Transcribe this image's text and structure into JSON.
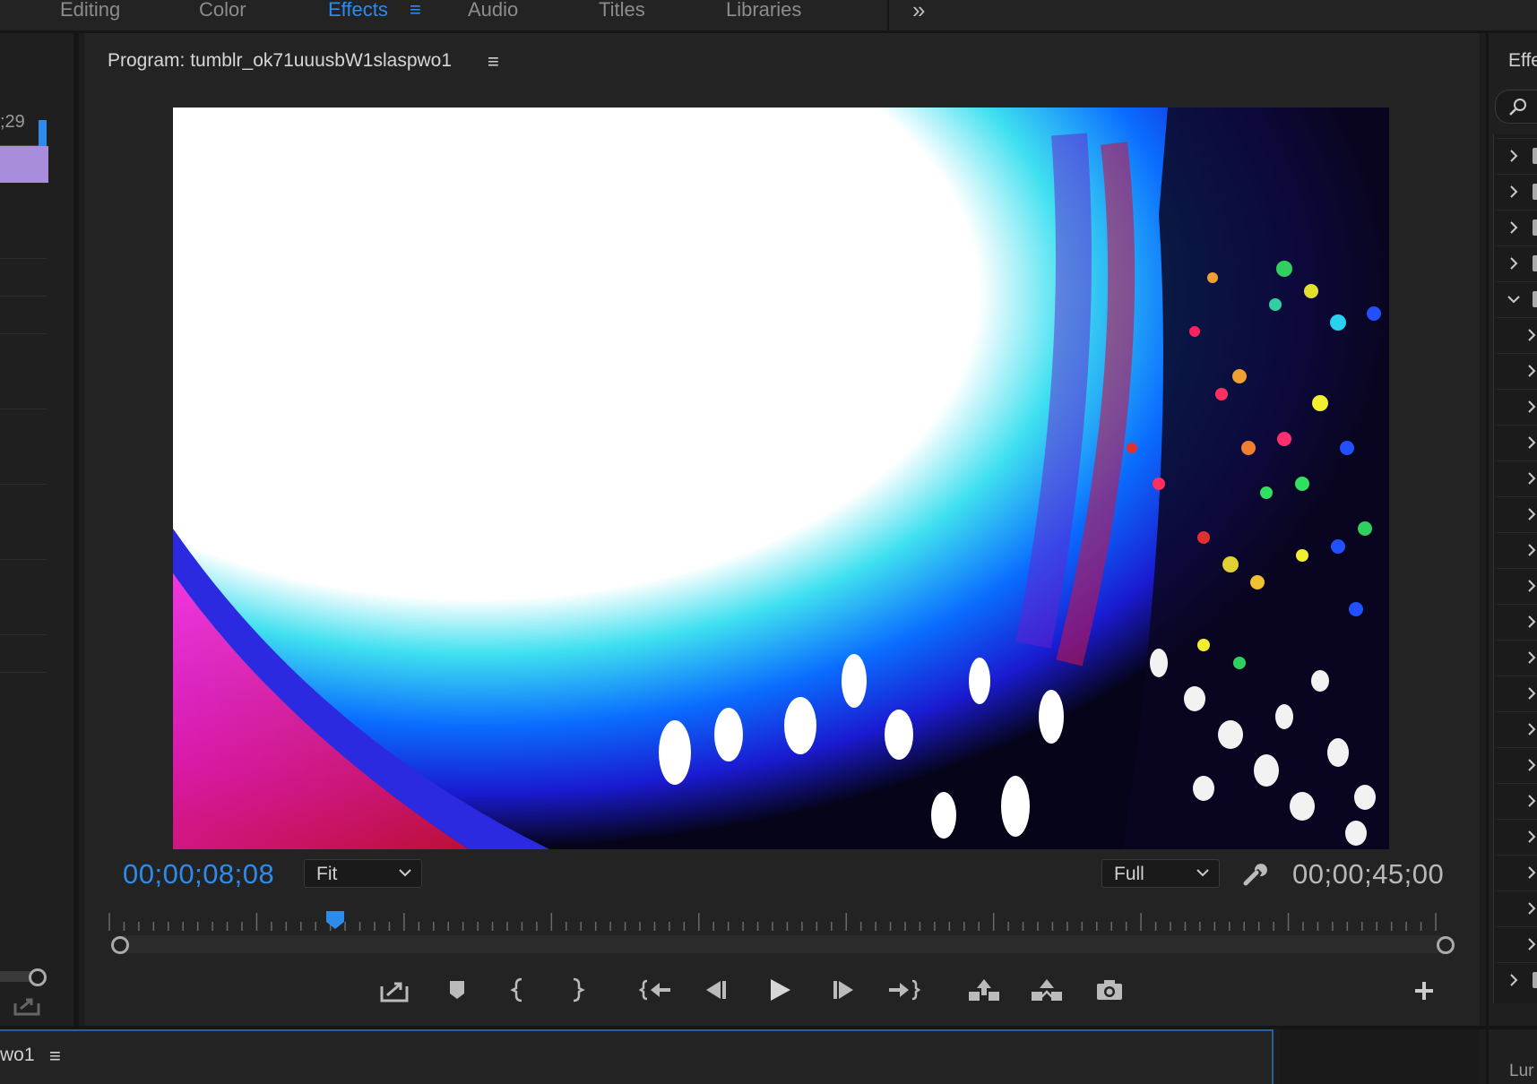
{
  "workspace_tabs": [
    {
      "label": "Editing",
      "active": false
    },
    {
      "label": "Color",
      "active": false
    },
    {
      "label": "Effects",
      "active": true
    },
    {
      "label": "Audio",
      "active": false
    },
    {
      "label": "Titles",
      "active": false
    },
    {
      "label": "Libraries",
      "active": false
    }
  ],
  "workspace": {
    "menu_icon": "≡",
    "overflow_icon": "»"
  },
  "left_panel": {
    "timecode_fragment": ";29"
  },
  "program_monitor": {
    "title": "Program: tumblr_ok71uuusbW1slaspwo1",
    "menu_icon": "≡",
    "current_timecode": "00;00;08;08",
    "duration_timecode": "00;00;45;00",
    "zoom_dropdown": "Fit",
    "resolution_dropdown": "Full",
    "playhead_position": 0.17
  },
  "transport": {
    "buttons": [
      "export-frame-icon",
      "add-marker-icon",
      "mark-in-icon",
      "mark-out-icon",
      "go-to-in-icon",
      "step-back-icon",
      "play-icon",
      "step-forward-icon",
      "go-to-out-icon",
      "lift-icon",
      "extract-icon",
      "export-camera-icon"
    ],
    "add_button": "+"
  },
  "effects_panel": {
    "title": "Effe",
    "bottom_tab": "Lur",
    "rows": 24
  },
  "timeline": {
    "name_fragment": "wo1",
    "menu_icon": "≡"
  },
  "colors": {
    "accent": "#2d8ceb",
    "clip": "#a78ddc",
    "background": "#1d1d1d"
  }
}
